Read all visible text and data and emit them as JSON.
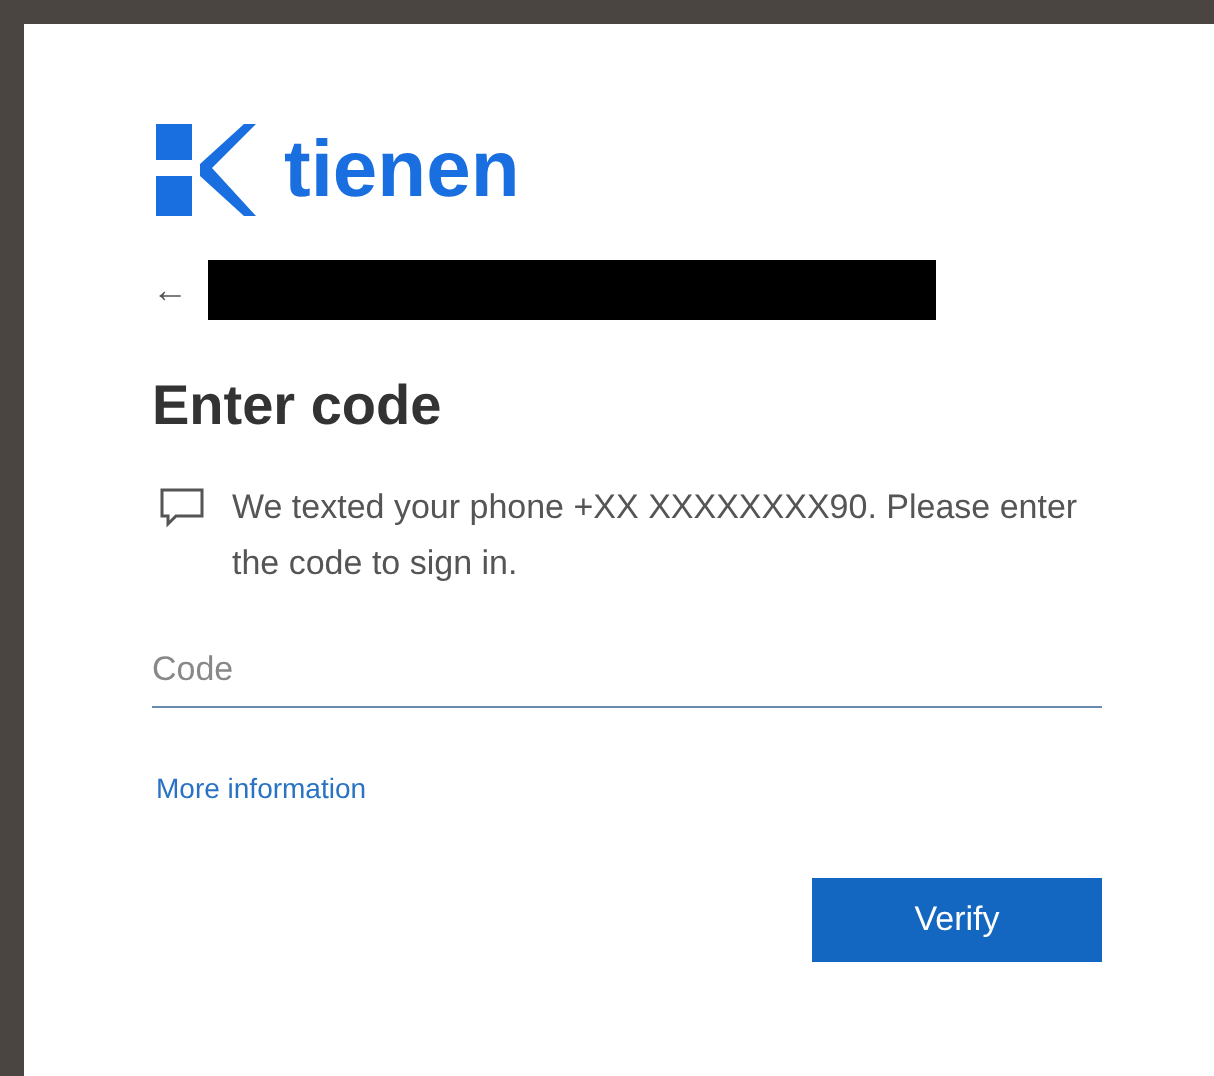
{
  "brand": {
    "name": "tienen"
  },
  "back": {
    "label": "←"
  },
  "title": "Enter code",
  "message": "We texted your phone +XX XXXXXXXX90. Please enter the code to sign in.",
  "code_field": {
    "placeholder": "Code"
  },
  "link": "More information",
  "buttons": [
    {
      "label": "Verify",
      "kind": "primary"
    }
  ]
}
